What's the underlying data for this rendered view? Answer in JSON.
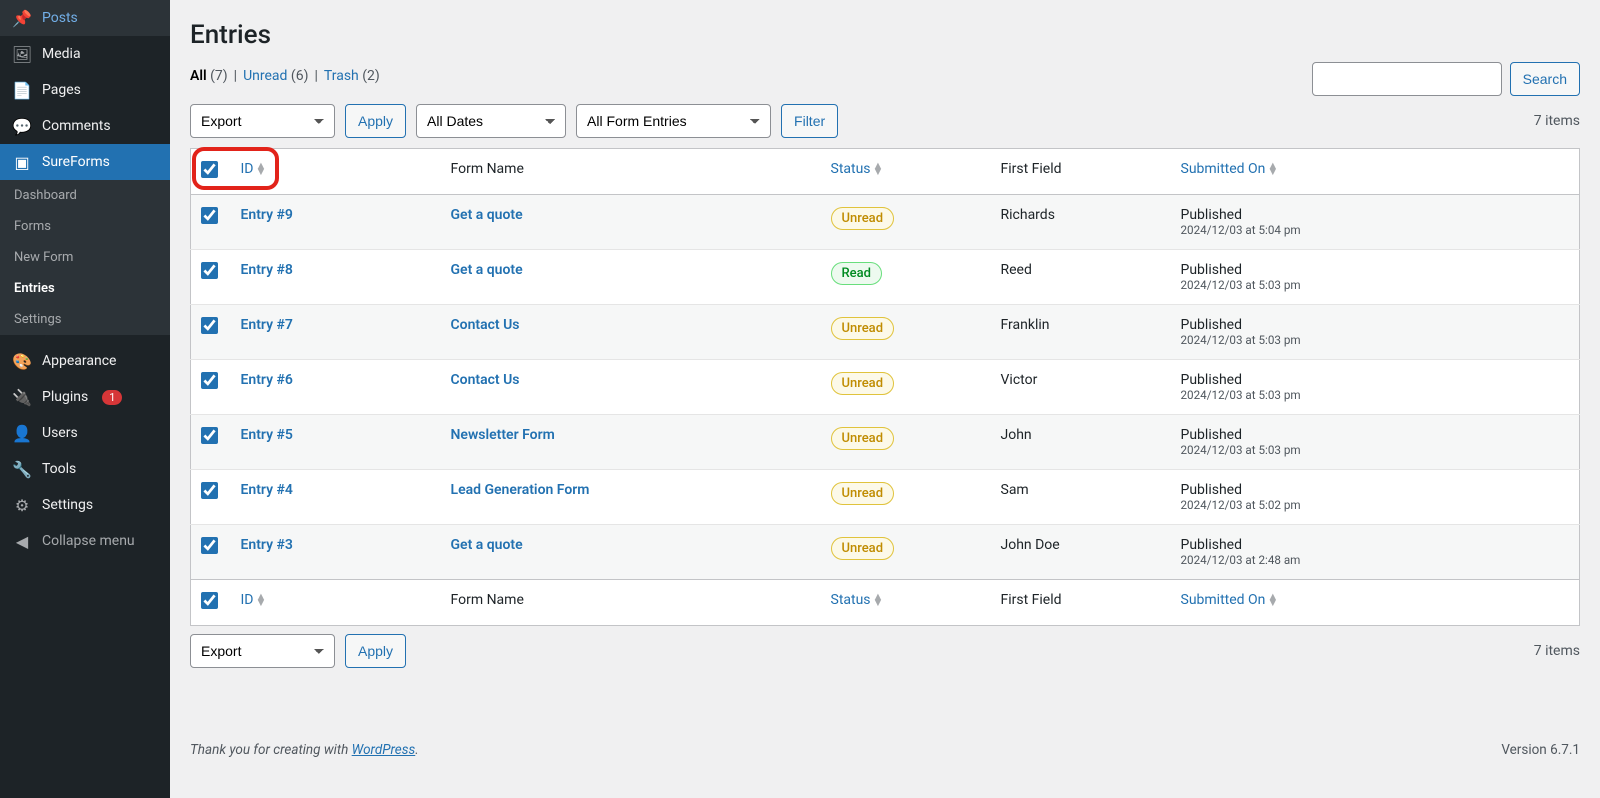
{
  "sidebar": {
    "items": [
      {
        "icon": "📌",
        "label": "Posts"
      },
      {
        "icon": "🖼",
        "label": "Media"
      },
      {
        "icon": "📄",
        "label": "Pages"
      },
      {
        "icon": "💬",
        "label": "Comments"
      }
    ],
    "current": {
      "icon": "▣",
      "label": "SureForms"
    },
    "submenu": [
      {
        "label": "Dashboard"
      },
      {
        "label": "Forms"
      },
      {
        "label": "New Form"
      },
      {
        "label": "Entries",
        "active": true
      },
      {
        "label": "Settings"
      }
    ],
    "lower": [
      {
        "icon": "🎨",
        "label": "Appearance"
      },
      {
        "icon": "🔌",
        "label": "Plugins",
        "badge": "1"
      },
      {
        "icon": "👤",
        "label": "Users"
      },
      {
        "icon": "🔧",
        "label": "Tools"
      },
      {
        "icon": "⚙",
        "label": "Settings"
      }
    ],
    "collapse": {
      "icon": "◀",
      "label": "Collapse menu"
    }
  },
  "page": {
    "title": "Entries",
    "filters": {
      "all_label": "All",
      "all_count": "(7)",
      "unread_label": "Unread",
      "unread_count": "(6)",
      "trash_label": "Trash",
      "trash_count": "(2)",
      "separator": "|"
    },
    "search_button": "Search",
    "bulk": {
      "export": "Export",
      "apply": "Apply",
      "dates": "All Dates",
      "forms": "All Form Entries",
      "filter": "Filter"
    },
    "items_count": "7 items",
    "columns": {
      "id": "ID",
      "form": "Form Name",
      "status": "Status",
      "first": "First Field",
      "submitted": "Submitted On"
    },
    "entries": [
      {
        "id": "Entry #9",
        "form": "Get a quote",
        "status": "Unread",
        "first": "Richards",
        "pub": "Published",
        "date": "2024/12/03 at 5:04 pm"
      },
      {
        "id": "Entry #8",
        "form": "Get a quote",
        "status": "Read",
        "first": "Reed",
        "pub": "Published",
        "date": "2024/12/03 at 5:03 pm"
      },
      {
        "id": "Entry #7",
        "form": "Contact Us",
        "status": "Unread",
        "first": "Franklin",
        "pub": "Published",
        "date": "2024/12/03 at 5:03 pm"
      },
      {
        "id": "Entry #6",
        "form": "Contact Us",
        "status": "Unread",
        "first": "Victor",
        "pub": "Published",
        "date": "2024/12/03 at 5:03 pm"
      },
      {
        "id": "Entry #5",
        "form": "Newsletter Form",
        "status": "Unread",
        "first": "John",
        "pub": "Published",
        "date": "2024/12/03 at 5:03 pm"
      },
      {
        "id": "Entry #4",
        "form": "Lead Generation Form",
        "status": "Unread",
        "first": "Sam",
        "pub": "Published",
        "date": "2024/12/03 at 5:02 pm"
      },
      {
        "id": "Entry #3",
        "form": "Get a quote",
        "status": "Unread",
        "first": "John Doe",
        "pub": "Published",
        "date": "2024/12/03 at 2:48 am"
      }
    ],
    "footer": {
      "thanks_pre": "Thank you for creating with ",
      "thanks_link": "WordPress",
      "thanks_post": ".",
      "version": "Version 6.7.1"
    }
  }
}
